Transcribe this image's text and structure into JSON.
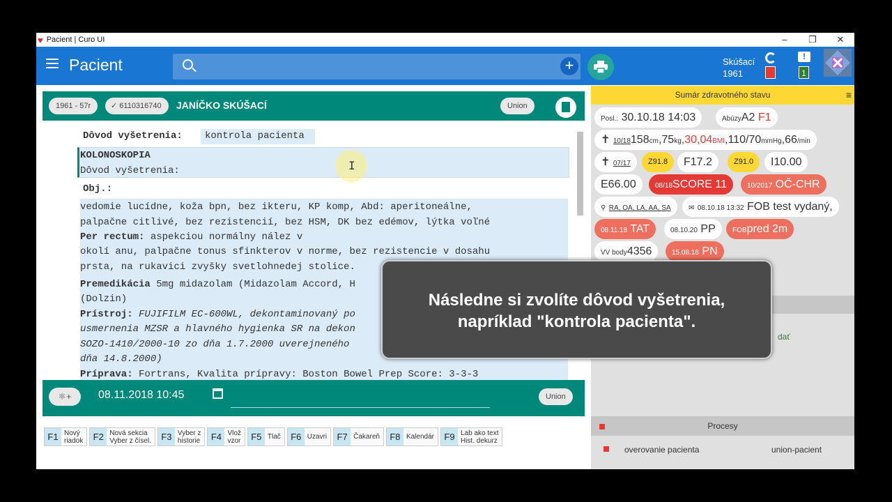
{
  "window": {
    "title": "Pacient | Curo UI",
    "controls": [
      "–",
      "❐",
      "✕"
    ]
  },
  "appbar": {
    "title": "Pacient",
    "user_name": "Skúšací",
    "user_year": "1961",
    "sync_badge": "1",
    "msg_badge": "1"
  },
  "patient": {
    "age_chip": "1961 - 57r",
    "id_chip": "6110316740",
    "name": "JANÍČKO SKÚŠACÍ",
    "insurer_chip": "Union"
  },
  "editor": {
    "reason_label": "Dôvod vyšetrenia:",
    "reason_value": "kontrola pacienta",
    "section_title": "KOLONOSKOPIA",
    "section_reason": "Dôvod vyšetrenia:",
    "obj_label": "Obj.:",
    "obj_lines": [
      "vedomie lucídne, koža bpn, bez ikteru, KP komp, Abd:  aperitoneálne,",
      "palpačne citlivé, bez rezistencií, bez HSM, DK bez edémov, lýtka voľné"
    ],
    "per_rectum_label": "Per rectum:",
    "per_rectum_value": "aspekciou normálny nález v",
    "per_rectum_lines": [
      "okolí anu, palpačne tonus sfinkterov v norme, bez rezistencie v dosahu",
      "prsta, na rukavici zvyšky svetlohnedej stolice."
    ],
    "premed_label": "Premedikácia",
    "premed_value": "5mg midazolam (Midazolam Accord, H",
    "premed_line2": "(Dolzin)",
    "device_label": "Prístroj:",
    "device_value": "FUJIFILM EC-600WL, dekontaminovaný po",
    "device_lines": [
      "usmernenia MZSR a hlavného hygienka SR na dekon",
      "SOZO-1410/2000-10 zo dňa 1.7.2000 uverejneného",
      "dňa 14.8.2000)"
    ],
    "prep_label": "Príprava:",
    "prep_value": "Fortrans, Kvalita prípravy: Boston Bowel Prep Score: 3-3-3"
  },
  "footer": {
    "datetime": "08.11.2018 10:45",
    "insurer": "Union"
  },
  "fkeys": [
    {
      "key": "F1",
      "l1": "Nový",
      "l2": "riadok"
    },
    {
      "key": "F2",
      "l1": "Nová sekcia",
      "l2": "Vyber z čísel."
    },
    {
      "key": "F3",
      "l1": "Vyber z",
      "l2": "historie"
    },
    {
      "key": "F4",
      "l1": "Vlož",
      "l2": "vzor"
    },
    {
      "key": "F5",
      "l1": "Tlač",
      "l2": ""
    },
    {
      "key": "F6",
      "l1": "Uzavri",
      "l2": ""
    },
    {
      "key": "F7",
      "l1": "Čakareň",
      "l2": ""
    },
    {
      "key": "F8",
      "l1": "Kalendár",
      "l2": ""
    },
    {
      "key": "F9",
      "l1": "Lab ako text",
      "l2": "Hist. dekurz"
    }
  ],
  "summary": {
    "title": "Sumár zdravotného stavu",
    "last_visit_label": "Posl.:",
    "last_visit": "30.10.18 14:03",
    "abuse_label": "Abúzy",
    "abuse_a": "A2",
    "abuse_f": "F1",
    "vitals_date": "10/18",
    "height": "158",
    "height_unit": "cm",
    "weight": ",75",
    "weight_unit": "kg",
    "bmi": ",30,04",
    "bmi_unit": "BMI",
    "bp": ",110/70",
    "bp_unit": "mmHg",
    "pulse": ",66",
    "pulse_unit": "/min",
    "dx_date": "07/17",
    "dx1": "Z91.8",
    "dx2": "F17.2",
    "dx3": "Z91.0",
    "dx4": "I10.00",
    "dx5": "E66.00",
    "score_date": "08/18",
    "score": "SCORE 11",
    "chr_date": "10/2017",
    "chr": "OČ-CHR",
    "labs": "RA, OA, LA, AA, SA",
    "fob_date": "08.10.18 13:32",
    "fob": "FOB test vydaný,",
    "tat_date": "08.11.18",
    "tat": "TAT",
    "pp_date": "08.10.20",
    "pp": "PP",
    "fobpred_prefix": "FOB",
    "fobpred": "pred 2m",
    "vv_label": "VV body",
    "vv_value": "4356",
    "pn_date": "15.08.18",
    "pn": "PN",
    "hidden_text": "dať"
  },
  "processes": {
    "title": "Procesy",
    "rows": [
      {
        "name": "overovanie pacienta",
        "value": "union-pacient"
      }
    ]
  },
  "overlay": {
    "line1": "Následne si zvolíte dôvod vyšetrenia,",
    "line2": "napríklad \"kontrola pacienta\"."
  }
}
